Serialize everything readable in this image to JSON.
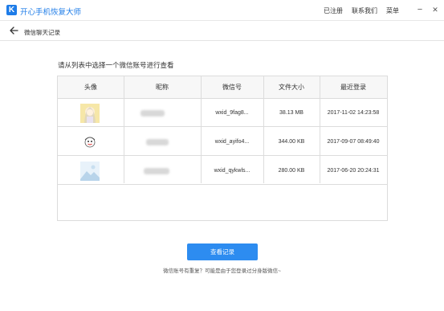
{
  "app": {
    "logo_letter": "K",
    "title": "开心手机恢复大师",
    "top_links": [
      "已注册",
      "联系我们",
      "菜单"
    ],
    "minimize_glyph": "−",
    "close_glyph": "✕",
    "brand_color": "#1e7ce8"
  },
  "breadcrumb": {
    "label": "微信聊天记录"
  },
  "main": {
    "instruction": "请从列表中选择一个微信账号进行查看",
    "table": {
      "headers": [
        "头像",
        "昵称",
        "微信号",
        "文件大小",
        "最近登录"
      ],
      "rows": [
        {
          "avatar_icon": "anime-girl-avatar-icon",
          "nickname": "",
          "wechat_id": "wxid_9fag8...",
          "file_size": "38.13 MB",
          "last_login": "2017-11-02 14:23:58"
        },
        {
          "avatar_icon": "cartoon-character-avatar-icon",
          "nickname": "",
          "wechat_id": "wxid_ayifo4...",
          "file_size": "344.00 KB",
          "last_login": "2017-09-07 08:49:40"
        },
        {
          "avatar_icon": "landscape-photo-avatar-icon",
          "nickname": "",
          "wechat_id": "wxid_qykwls...",
          "file_size": "280.00 KB",
          "last_login": "2017-06-20 20:24:31"
        }
      ]
    },
    "view_button": "查看记录",
    "hint": "微信账号有重复？可能是由于您登录过分身版微信~",
    "accent_color": "#2d8cf0"
  }
}
